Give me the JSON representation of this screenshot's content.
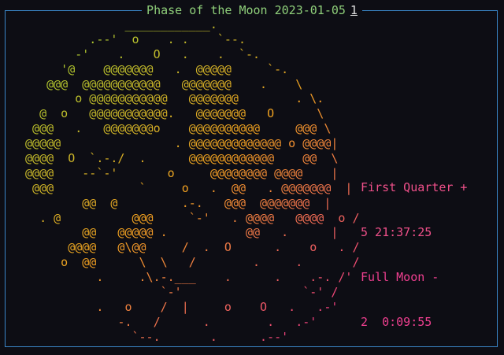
{
  "window": {
    "title": "Phase of the Moon 2023-01-05",
    "index": "1"
  },
  "moon_art": {
    "lines": [
      "              ____________.",
      "         .--'  o    . .    `--.",
      "       -'    .    O   .    .  `-.",
      "     '@    @@@@@@@   .  @@@@@     `-.",
      "   @@@  @@@@@@@@@@@   @@@@@@@    .    \\",
      "       o @@@@@@@@@@@   @@@@@@@        . \\.",
      "  @  o   @@@@@@@@@@@.   @@@@@@@   O      \\",
      " @@@   .   @@@@@@@o    @@@@@@@@@@     @@@ \\",
      "@@@@@                . @@@@@@@@@@@@@ o @@@@|",
      "@@@@  O  `.-./  .      @@@@@@@@@@@@    @@  \\",
      "@@@@    --`-'       o     @@@@@@@@ @@@@    |",
      " @@@            `     o   .  @@   . @@@@@@@  |",
      "        @@  @         .-.   @@@  @@@@@@@  |",
      "  . @          @@@     `-'   . @@@@   @@@@  o /",
      "        @@   @@@@@ .           @@   .      |",
      "      @@@@   @\\@@     /  .  O      .    o   . /",
      "     o  @@      \\  \\   /        .     .       /",
      "          .     .\\.-.___    .      .    .-. /'",
      "                   `-'                 `-' /",
      "          .   o    /  |     o    O   .   .-'",
      "             -.   /      .        .   .-'",
      "               `--.       .      .--'"
    ]
  },
  "info": {
    "first_quarter_label": "First Quarter +",
    "first_quarter_value": "5 21:37:25",
    "full_moon_label": "Full Moon -",
    "full_moon_value": "2  0:09:55"
  },
  "colors": {
    "border": "#3a86c8",
    "title": "#8fcf7a",
    "gradient_top": "#9ad334",
    "gradient_mid": "#f0a020",
    "gradient_bottom": "#ee2f8f",
    "info_text": "#ee3f8f",
    "background": "#0d0d14"
  }
}
